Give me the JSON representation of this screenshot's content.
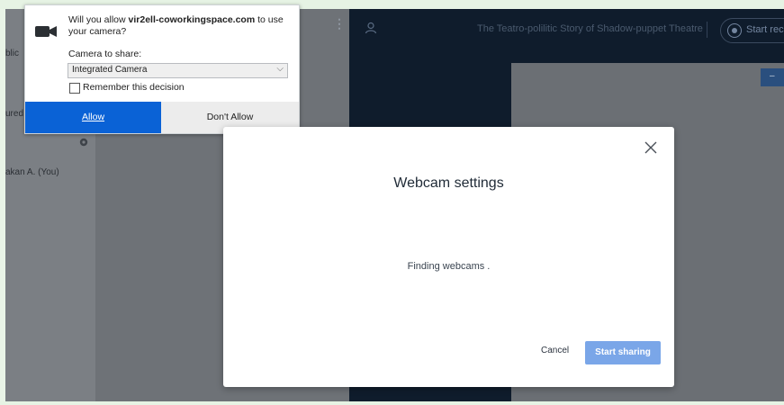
{
  "app": {
    "meeting_title": "The Teatro-polilitic Story of Shadow-puppet Theatre",
    "record_button_label": "Start rec",
    "left_labels": [
      "blic",
      "ured",
      "akan A. (You)"
    ]
  },
  "permission_popup": {
    "question_prefix": "Will you allow ",
    "site": "vir2ell-coworkingspace.com",
    "question_suffix": " to use your camera?",
    "camera_label": "Camera to share:",
    "camera_selected": "Integrated Camera",
    "remember_label": "Remember this decision",
    "remember_checked": false,
    "allow_label": "Allow",
    "dont_allow_label": "Don't Allow"
  },
  "webcam_modal": {
    "title": "Webcam settings",
    "status": "Finding webcams .",
    "cancel_label": "Cancel",
    "start_label": "Start sharing"
  },
  "right_strip_label": "–",
  "colors": {
    "allow_blue": "#0a62d6",
    "start_button": "#7aa6e8",
    "app_dark": "#0f1c2c"
  },
  "icons": [
    "camera-icon",
    "user-icon",
    "record-icon",
    "gear-icon",
    "close-icon",
    "kebab-menu-icon",
    "chevron-down-icon"
  ]
}
